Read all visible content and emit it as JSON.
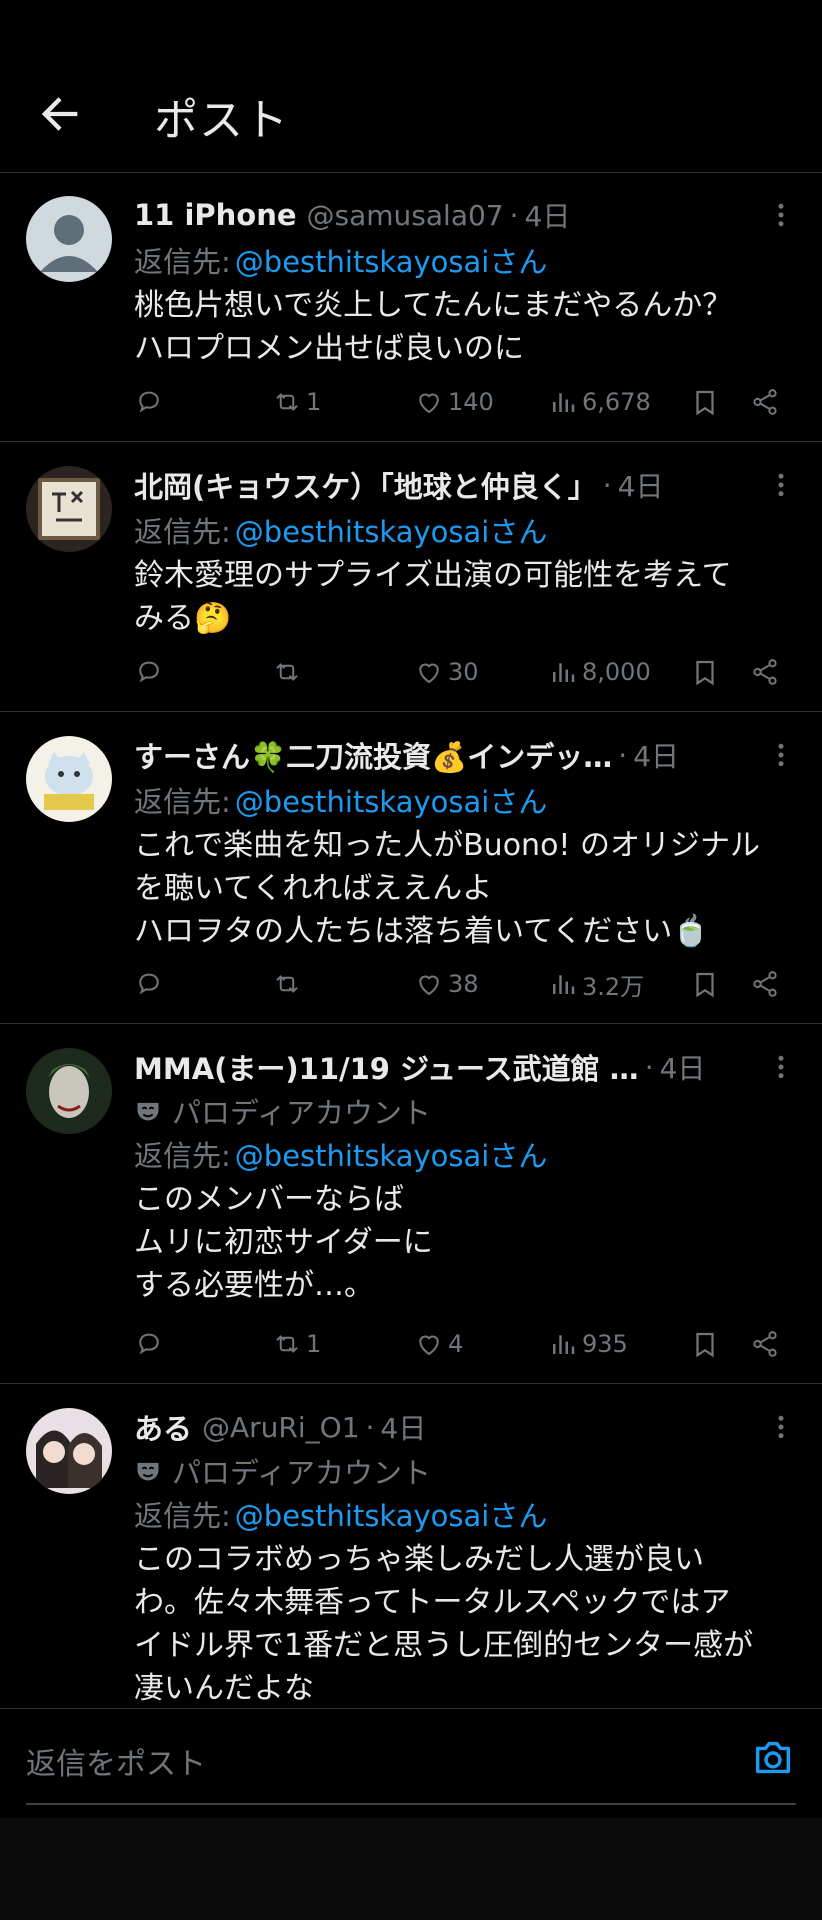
{
  "header": {
    "title": "ポスト"
  },
  "reply_prefix": "返信先:",
  "tweets": [
    {
      "name": "11 iPhone",
      "handle": "@samusala07",
      "time": "4日",
      "reply_to": "@besthitskayosaiさん",
      "lines": [
        "桃色片想いで炎上してたんにまだやるんか？",
        "ハロプロメン出せば良いのに"
      ],
      "replies": "",
      "reposts": "1",
      "likes": "140",
      "views": "6,678"
    },
    {
      "name": "北岡(キョウスケ）「地球と仲良く」",
      "handle": "",
      "time": "4日",
      "reply_to": "@besthitskayosaiさん",
      "lines": [
        "鈴木愛理のサプライズ出演の可能性を考えて",
        "みる🤔"
      ],
      "replies": "",
      "reposts": "",
      "likes": "30",
      "views": "8,000"
    },
    {
      "name": "すーさん🍀二刀流投資💰インデッ…",
      "handle": "",
      "time": "4日",
      "reply_to": "@besthitskayosaiさん",
      "lines": [
        "これで楽曲を知った人がBuono! のオリジナル",
        "を聴いてくれればええんよ",
        "ハロヲタの人たちは落ち着いてください🍵"
      ],
      "replies": "",
      "reposts": "",
      "likes": "38",
      "views": "3.2万"
    },
    {
      "name": "MMA(まー)11/19 ジュース武道館 …",
      "handle": "",
      "time": "4日",
      "parody": "パロディアカウント",
      "reply_to": "@besthitskayosaiさん",
      "lines": [
        "このメンバーならば",
        "ムリに初恋サイダーに",
        "する必要性が…。"
      ],
      "replies": "",
      "reposts": "1",
      "likes": "4",
      "views": "935"
    },
    {
      "name": "ある",
      "handle": "@AruRi_O1",
      "time": "4日",
      "parody": "パロディアカウント",
      "reply_to": "@besthitskayosaiさん",
      "lines": [
        "このコラボめっちゃ楽しみだし人選が良い",
        "わ。佐々木舞香ってトータルスペックではア",
        "イドル界で1番だと思うし圧倒的センター感が",
        "凄いんだよな"
      ]
    }
  ],
  "composer": {
    "placeholder": "返信をポスト"
  },
  "colors": {
    "background": "#000000",
    "accent": "#1d9bf0",
    "muted": "#71767b",
    "text": "#e7e9ea"
  }
}
